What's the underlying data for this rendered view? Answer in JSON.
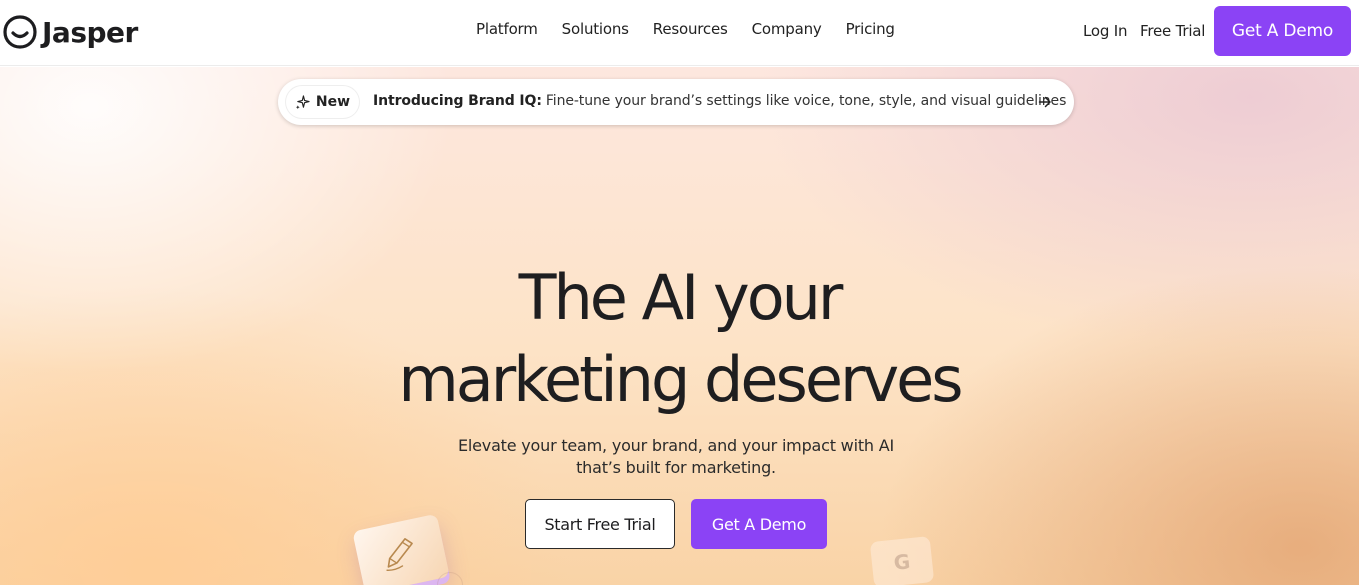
{
  "header": {
    "brand": "Jasper",
    "nav": [
      {
        "label": "Platform"
      },
      {
        "label": "Solutions"
      },
      {
        "label": "Resources"
      },
      {
        "label": "Company"
      },
      {
        "label": "Pricing"
      }
    ],
    "login_label": "Log In",
    "free_trial_label": "Free Trial",
    "demo_label": "Get A Demo"
  },
  "announcement": {
    "badge": "New",
    "strong": "Introducing Brand IQ:",
    "text": "Fine-tune your brand’s settings like voice, tone, style, and visual guidelines",
    "icon": "sparkle-icon",
    "arrow_icon": "arrow-right-icon"
  },
  "hero": {
    "headline_line1": "The AI your",
    "headline_line2": "marketing deserves",
    "subhead_line1": "Elevate your team, your brand, and your impact with AI",
    "subhead_line2": "that’s built for marketing.",
    "cta_secondary": "Start Free Trial",
    "cta_primary": "Get A Demo",
    "deco_letter": "G"
  },
  "colors": {
    "accent": "#8b43f5",
    "text": "#1e1e20"
  }
}
